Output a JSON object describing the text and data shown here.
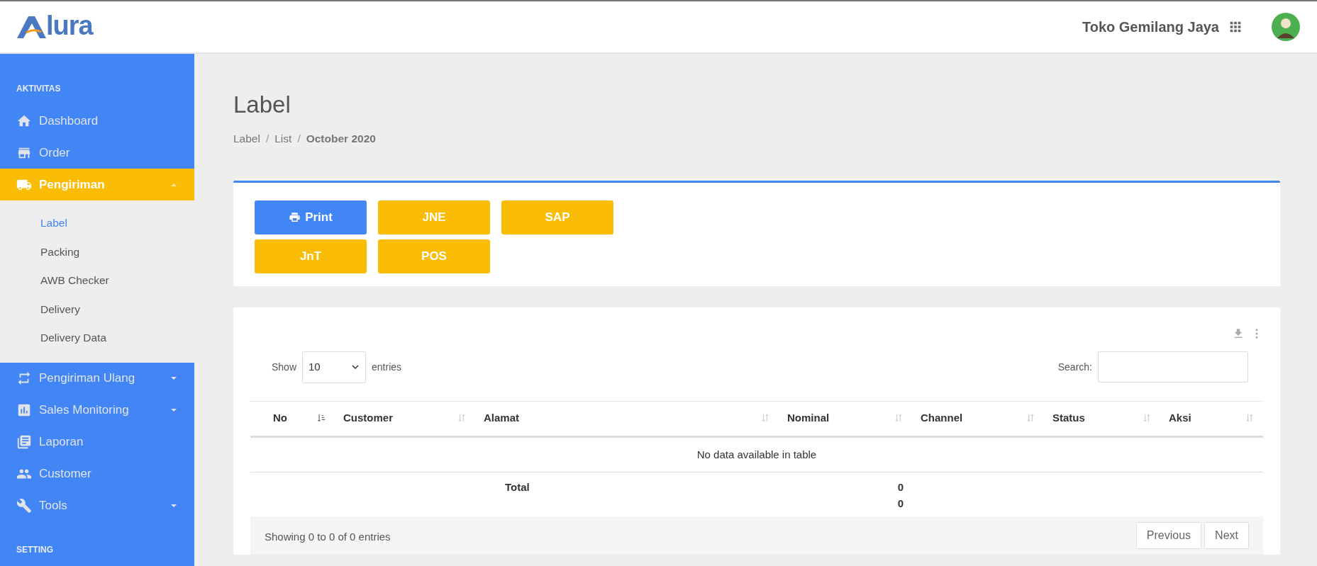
{
  "header": {
    "logo_text": "lura",
    "store_name": "Toko Gemilang Jaya"
  },
  "sidebar": {
    "sections": [
      {
        "title": "AKTIVITAS",
        "items": [
          {
            "label": "Dashboard",
            "selected": false
          },
          {
            "label": "Order",
            "selected": false
          },
          {
            "label": "Pengiriman",
            "selected": true,
            "expanded": true,
            "children": [
              {
                "label": "Label",
                "selected": true
              },
              {
                "label": "Packing",
                "selected": false
              },
              {
                "label": "AWB Checker",
                "selected": false
              },
              {
                "label": "Delivery",
                "selected": false
              },
              {
                "label": "Delivery Data",
                "selected": false
              }
            ]
          },
          {
            "label": "Pengiriman Ulang",
            "selected": false,
            "expanded": false
          },
          {
            "label": "Sales Monitoring",
            "selected": false,
            "expanded": false
          },
          {
            "label": "Laporan",
            "selected": false
          },
          {
            "label": "Customer",
            "selected": false
          },
          {
            "label": "Tools",
            "selected": false,
            "expanded": false
          }
        ]
      },
      {
        "title": "SETTING"
      }
    ]
  },
  "page": {
    "title": "Label",
    "breadcrumb_separator": "/",
    "breadcrumb": [
      {
        "label": "Label",
        "current": false
      },
      {
        "label": "List",
        "current": false
      },
      {
        "label": "October 2020",
        "current": true
      }
    ]
  },
  "action_buttons": [
    {
      "label": "Print",
      "kind": "print"
    },
    {
      "label": "JNE",
      "kind": "courier"
    },
    {
      "label": "SAP",
      "kind": "courier"
    },
    {
      "label": "JnT",
      "kind": "courier"
    },
    {
      "label": "POS",
      "kind": "courier"
    }
  ],
  "table": {
    "length_label_before": "Show",
    "length_value": "10",
    "length_label_after": "entries",
    "search_label": "Search:",
    "columns": [
      {
        "label": "No",
        "sorted": true
      },
      {
        "label": "Customer",
        "sorted": false
      },
      {
        "label": "Alamat",
        "sorted": false
      },
      {
        "label": "Nominal",
        "sorted": false
      },
      {
        "label": "Channel",
        "sorted": false
      },
      {
        "label": "Status",
        "sorted": false
      },
      {
        "label": "Aksi",
        "sorted": false
      }
    ],
    "empty_message": "No data available in table",
    "total": {
      "label": "Total",
      "values": [
        "0",
        "0"
      ]
    },
    "info": "Showing 0 to 0 of 0 entries",
    "pagination": [
      "Previous",
      "Next"
    ]
  }
}
